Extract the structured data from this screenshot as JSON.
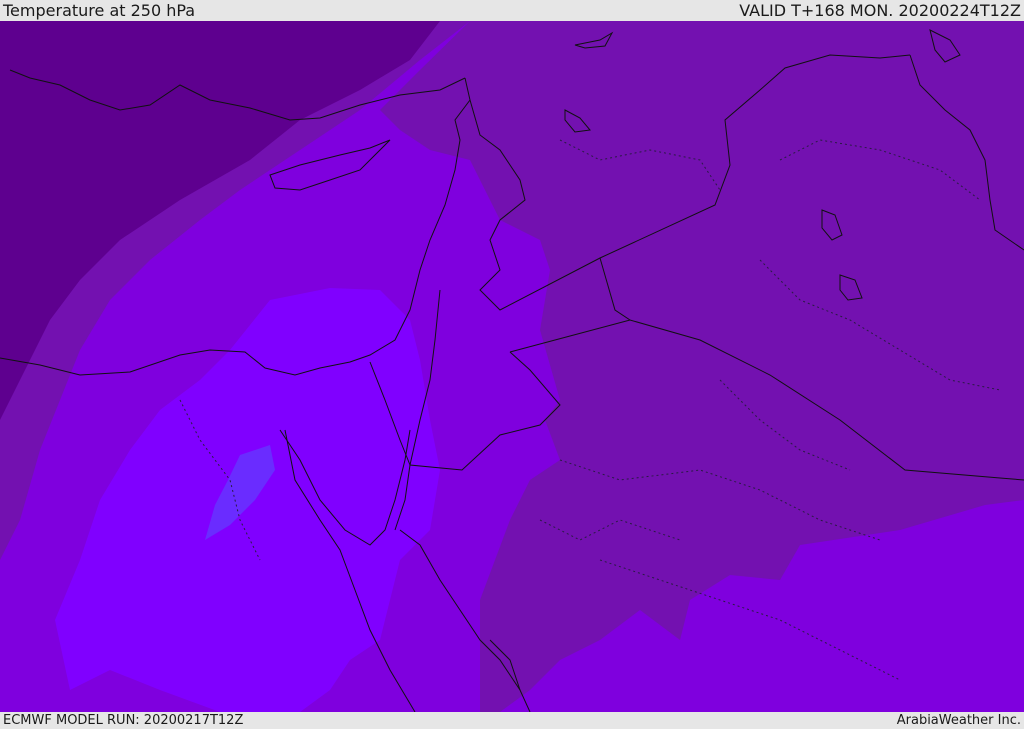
{
  "header": {
    "title": "Temperature at 250 hPa",
    "valid_time": "VALID T+168 MON. 20200224T12Z"
  },
  "footer": {
    "model_run": "ECMWF MODEL RUN: 20200217T12Z",
    "credit": "ArabiaWeather Inc."
  },
  "map": {
    "field": "temperature-250hPa",
    "palette": {
      "darkest": "#5e008f",
      "dark": "#7311b0",
      "mid": "#7a10c4",
      "base": "#7f00de",
      "light": "#8000ff",
      "lightest": "#6a2cff",
      "coast": "#111111",
      "border": "#111111"
    }
  }
}
